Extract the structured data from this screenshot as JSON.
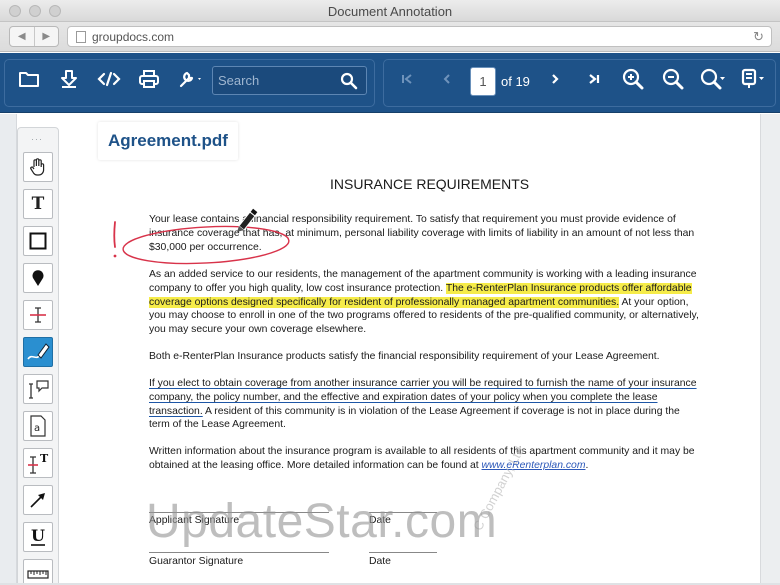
{
  "window": {
    "title": "Document Annotation"
  },
  "browser": {
    "url": "groupdocs.com",
    "back": "◀",
    "forward": "▶"
  },
  "toolbar": {
    "search_placeholder": "Search",
    "page_current": "1",
    "page_of": "of 19"
  },
  "file": {
    "name": "Agreement.pdf"
  },
  "document": {
    "title": "INSURANCE REQUIREMENTS",
    "p1": "Your lease contains a financial responsibility requirement.  To satisfy that requirement you must provide evidence of insurance coverage that has, at minimum, personal liability coverage with limits of liability in an amount of not less than $30,000 per occurrence.",
    "p2_a": "As an added service to our residents, the management of the apartment community is working with a leading insurance company to offer you high quality, low cost insurance protection. ",
    "p2_hl": "The e-RenterPlan Insurance products offer affordable coverage options designed specifically for resident of professionally managed apartment communities.",
    "p2_b": " At your option, you may choose to enroll in one of the two programs offered to residents of the pre-qualified community, or alternatively, you may secure your own coverage elsewhere.",
    "p3": "Both e-RenterPlan Insurance products satisfy the financial responsibility requirement of your Lease Agreement.",
    "p4_ul": "If you elect to obtain coverage from another insurance carrier you will be required to furnish the name of your insurance company, the policy number, and the effective and expiration dates of your policy when you complete the lease transaction.",
    "p4_b": "  A resident of this community is in violation of the Lease Agreement if coverage is not in place during the term of the Lease Agreement.",
    "p5_a": "Written information about the insurance program is available to all residents of this apartment community and it may be obtained at the leasing office.  More detailed information can be found at ",
    "p5_link": "www.eRenterplan.com",
    "p5_b": ".",
    "applicant_signature": "Applicant Signature",
    "date1": "Date",
    "guarantor_signature": "Guarantor Signature",
    "date2": "Date",
    "diagonal_watermark": "C Company, Ltd"
  },
  "watermark": "UpdateStar.com",
  "colors": {
    "toolbar": "#1e5288",
    "highlight": "#f6ec49",
    "active_tool": "#2a8fd0",
    "annotation_red": "#d8334a",
    "underline_blue": "#1d56a6"
  },
  "icons": {
    "toolbar": [
      "folder-icon",
      "download-icon",
      "code-icon",
      "print-icon",
      "wrench-icon",
      "search-icon",
      "first-page-icon",
      "prev-page-icon",
      "next-page-icon",
      "last-page-icon",
      "zoom-in-icon",
      "zoom-out-icon",
      "zoom-dropdown-icon",
      "save-dropdown-icon"
    ],
    "tools": [
      "hand-icon",
      "text-icon",
      "rectangle-icon",
      "point-icon",
      "strikeout-icon",
      "draw-icon",
      "text-comment-icon",
      "text-field-icon",
      "text-replace-icon",
      "arrow-icon",
      "underline-icon",
      "ruler-icon"
    ]
  }
}
